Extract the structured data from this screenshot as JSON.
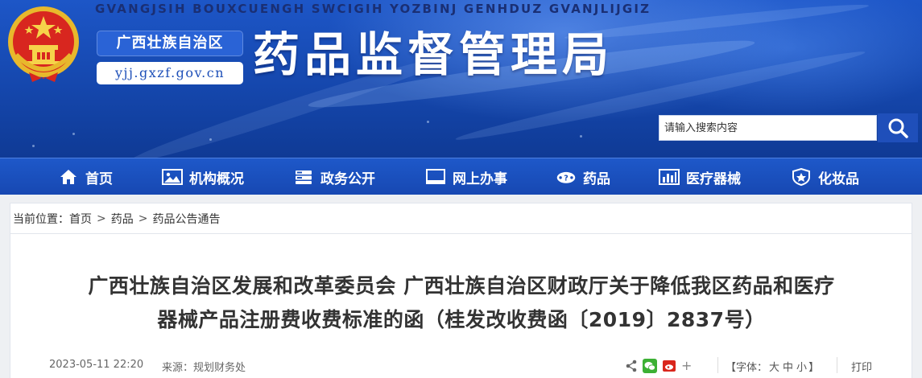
{
  "header": {
    "zhuang_title": "GVANGJSIH BOUXCUENGH SWCIGIH YOZBINJ GENHDUZ GVANJLIJGIZ",
    "region_name": "广西壮族自治区",
    "domain": "yjj.gxzf.gov.cn",
    "bureau_name": "药品监督管理局"
  },
  "search": {
    "placeholder": "请输入搜索内容"
  },
  "nav": {
    "items": [
      {
        "label": "首页",
        "icon": "home-icon"
      },
      {
        "label": "机构概况",
        "icon": "image-icon"
      },
      {
        "label": "政务公开",
        "icon": "server-icon"
      },
      {
        "label": "网上办事",
        "icon": "monitor-icon"
      },
      {
        "label": "药品",
        "icon": "pill-icon"
      },
      {
        "label": "医疗器械",
        "icon": "bar-chart-icon"
      },
      {
        "label": "化妆品",
        "icon": "shield-icon"
      }
    ]
  },
  "breadcrumb": {
    "prefix": "当前位置：",
    "items": [
      "首页",
      "药品",
      "药品公告通告"
    ],
    "separator": ">"
  },
  "article": {
    "title_line1": "广西壮族自治区发展和改革委员会 广西壮族自治区财政厅关于降低我区药品和医疗",
    "title_line2": "器械产品注册费收费标准的函（桂发改收费函〔2019〕2837号）",
    "date": "2023-05-11 22:20",
    "source_label": "来源：",
    "source": "规划财务处",
    "more_symbol": "+",
    "font_size_prefix": "【字体：",
    "font_size_large": "大",
    "font_size_medium": "中",
    "font_size_small": "小",
    "font_size_suffix": "】",
    "print_label": "打印"
  },
  "colors": {
    "banner_blue": "#1547ad",
    "nav_blue": "#1e58c9",
    "badge_blue": "#2a63d6",
    "wechat_green": "#3cb034",
    "weibo_red": "#d9261c"
  }
}
